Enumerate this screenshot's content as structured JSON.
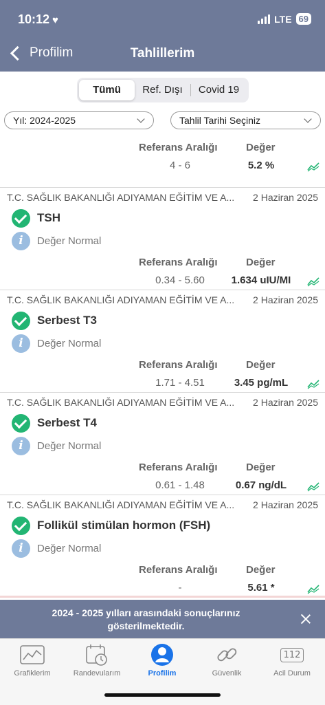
{
  "status": {
    "time": "10:12",
    "network": "LTE",
    "battery": "69"
  },
  "nav": {
    "back_label": "Profilim",
    "title": "Tahlillerim"
  },
  "segments": [
    "Tümü",
    "Ref. Dışı",
    "Covid 19"
  ],
  "filters": {
    "year": "Yıl: 2024-2025",
    "date": "Tahlil Tarihi Seçiniz"
  },
  "labels": {
    "ref_range": "Referans Aralığı",
    "value": "Değer"
  },
  "first_card": {
    "ref_range": "4 - 6",
    "value": "5.2 %"
  },
  "results": [
    {
      "source": "T.C. SAĞLIK BAKANLIĞI ADIYAMAN EĞİTİM VE A...",
      "date": "2 Haziran 2025",
      "name": "TSH",
      "status": "Değer Normal",
      "ref_range": "0.34 - 5.60",
      "value": "1.634 uIU/MI"
    },
    {
      "source": "T.C. SAĞLIK BAKANLIĞI ADIYAMAN EĞİTİM VE A...",
      "date": "2 Haziran 2025",
      "name": "Serbest T3",
      "status": "Değer Normal",
      "ref_range": "1.71 - 4.51",
      "value": "3.45 pg/mL"
    },
    {
      "source": "T.C. SAĞLIK BAKANLIĞI ADIYAMAN EĞİTİM VE A...",
      "date": "2 Haziran 2025",
      "name": "Serbest T4",
      "status": "Değer Normal",
      "ref_range": "0.61 - 1.48",
      "value": "0.67 ng/dL"
    },
    {
      "source": "T.C. SAĞLIK BAKANLIĞI ADIYAMAN EĞİTİM VE A...",
      "date": "2 Haziran 2025",
      "name": "Follikül stimülan hormon (FSH)",
      "status": "Değer Normal",
      "ref_range": "-",
      "value": "5.61 *"
    }
  ],
  "toast": {
    "text": "2024 - 2025 yılları arasındaki sonuçlarınız gösterilmektedir."
  },
  "tabs": [
    "Grafiklerim",
    "Randevularım",
    "Profilim",
    "Güvenlik",
    "Acil Durum"
  ],
  "tab_icon_text": {
    "emergency": "112"
  },
  "colors": {
    "header": "#6e7a99",
    "check": "#22b573",
    "info": "#9bbde0",
    "active_tab": "#1a73e8",
    "trend": "#22b573"
  },
  "icons": {
    "check": "check-circle-icon",
    "info": "info-icon",
    "trend": "trend-chart-icon"
  }
}
